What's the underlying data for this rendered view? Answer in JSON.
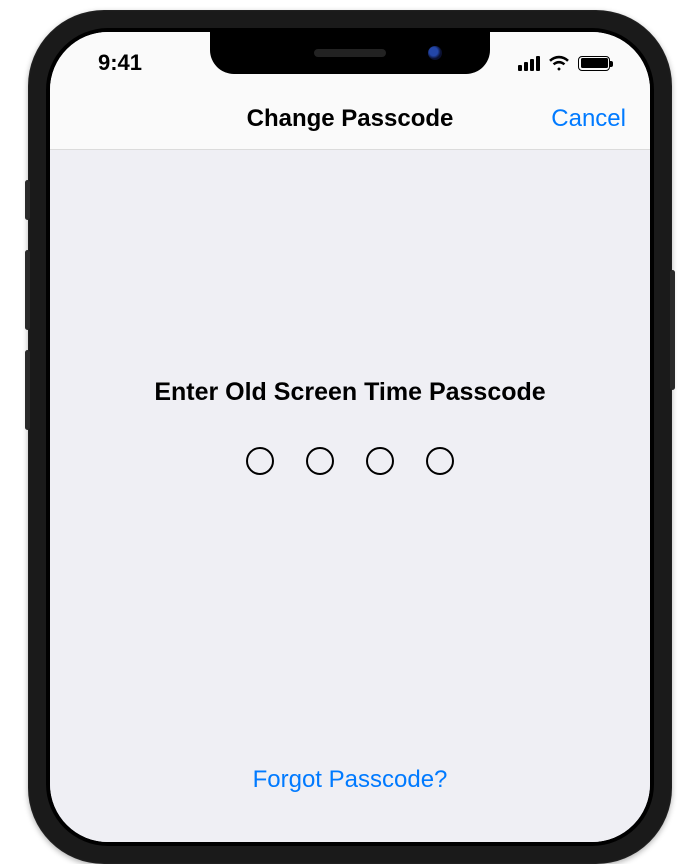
{
  "status": {
    "time": "9:41"
  },
  "nav": {
    "title": "Change Passcode",
    "cancel": "Cancel"
  },
  "content": {
    "prompt": "Enter Old Screen Time Passcode",
    "forgot": "Forgot Passcode?",
    "digits": 4,
    "entered": 0
  },
  "colors": {
    "link": "#007aff",
    "background": "#efeff4",
    "header": "#fafafa"
  }
}
